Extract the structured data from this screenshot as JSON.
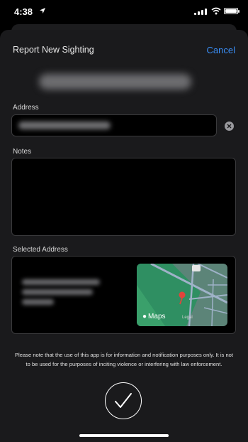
{
  "status_bar": {
    "time": "4:38"
  },
  "sheet": {
    "title": "Report New Sighting",
    "cancel_label": "Cancel"
  },
  "form": {
    "address_label": "Address",
    "notes_label": "Notes",
    "notes_value": "",
    "selected_address_label": "Selected Address"
  },
  "map": {
    "provider_label": "Maps",
    "legal_label": "Legal"
  },
  "disclaimer": "Please note that the use of this app is for information and notification purposes only. It is not to be used for the purposes of inciting violence or interfering with law enforcement.",
  "icons": {
    "location": "location-arrow-icon",
    "clear": "clear-circle-icon",
    "confirm": "checkmark-icon",
    "map_pin": "map-pin-icon"
  },
  "colors": {
    "accent": "#3a8ef6",
    "sheet_background": "#1a1a1c",
    "pin": "#e0443c"
  }
}
